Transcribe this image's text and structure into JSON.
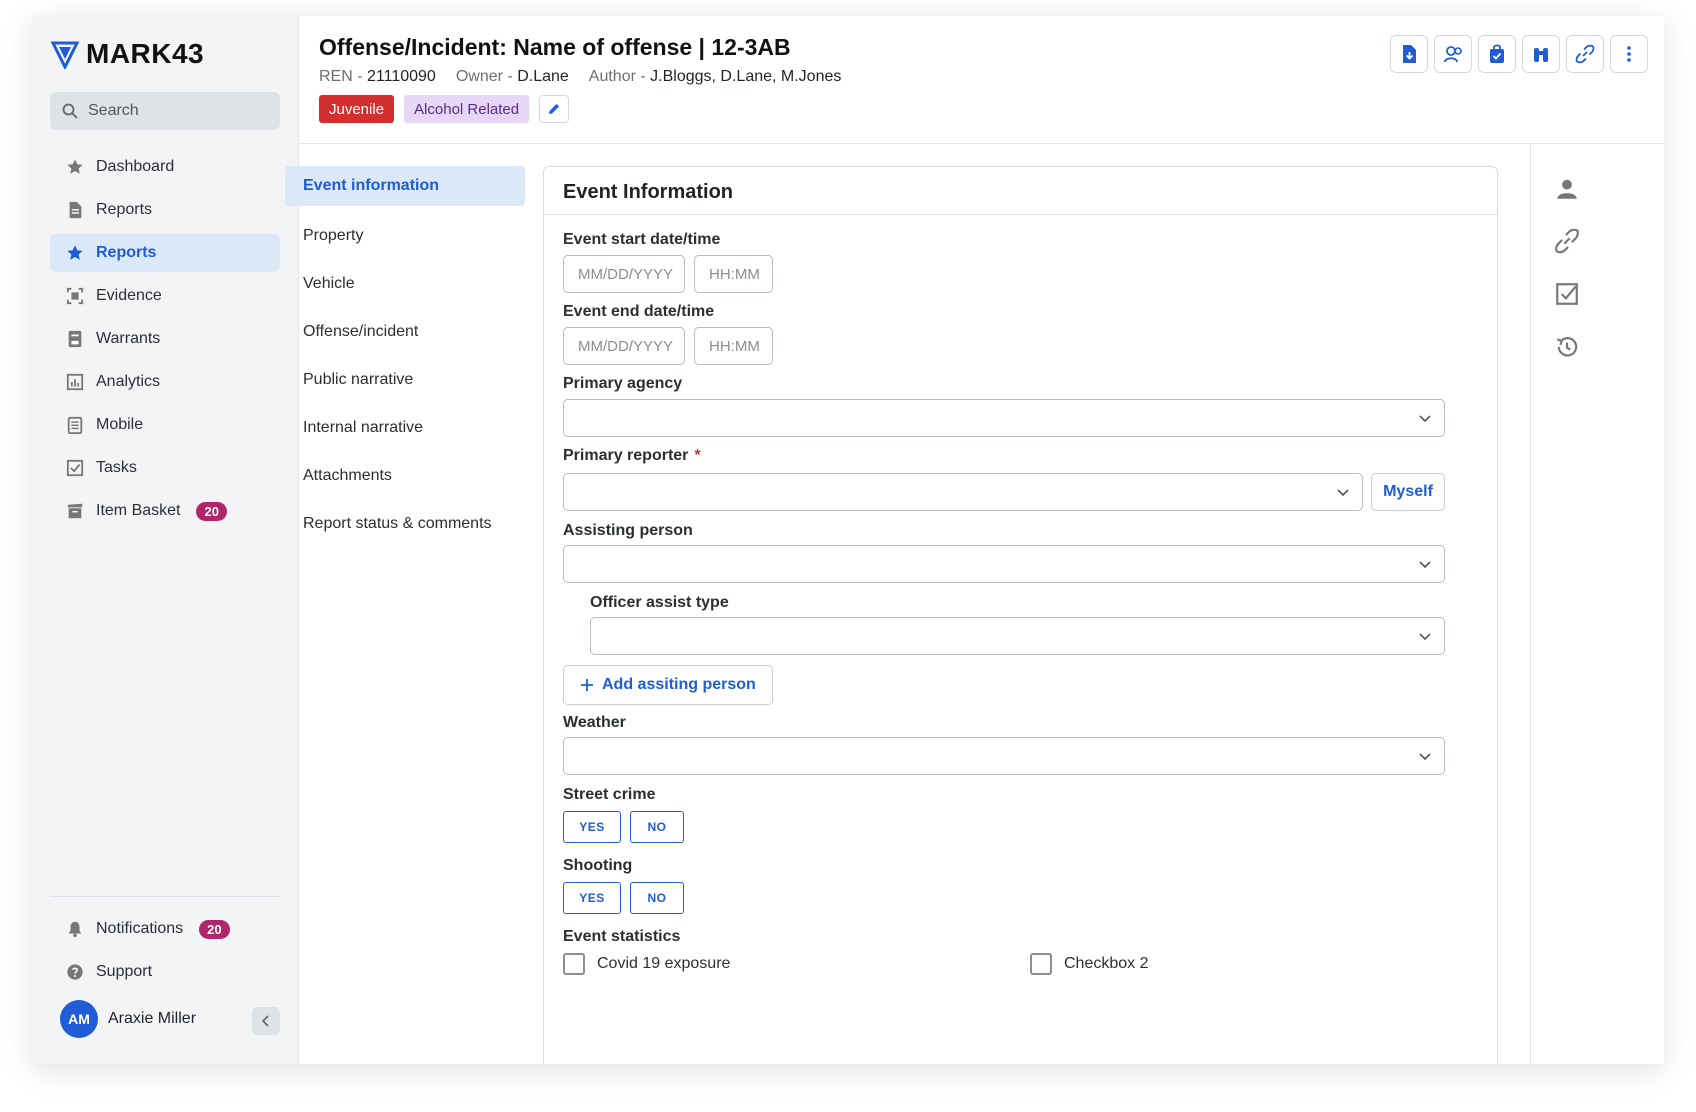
{
  "app": {
    "logo": "MARK43"
  },
  "sidebar": {
    "search_placeholder": "Search",
    "items": [
      {
        "label": "Dashboard",
        "icon": "star-icon",
        "active": false
      },
      {
        "label": "Reports",
        "icon": "document-icon",
        "active": false
      },
      {
        "label": "Reports",
        "icon": "star-icon",
        "active": true
      },
      {
        "label": "Evidence",
        "icon": "evidence-icon",
        "active": false
      },
      {
        "label": "Warrants",
        "icon": "warrant-icon",
        "active": false
      },
      {
        "label": "Analytics",
        "icon": "analytics-icon",
        "active": false
      },
      {
        "label": "Mobile",
        "icon": "mobile-icon",
        "active": false
      },
      {
        "label": "Tasks",
        "icon": "tasks-icon",
        "active": false
      },
      {
        "label": "Item Basket",
        "icon": "basket-icon",
        "active": false,
        "badge": "20"
      }
    ],
    "bottom": {
      "notifications": {
        "label": "Notifications",
        "badge": "20"
      },
      "support": {
        "label": "Support"
      }
    },
    "user": {
      "initials": "AM",
      "name": "Araxie Miller"
    }
  },
  "header": {
    "title": "Offense/Incident: Name of offense | 12-3AB",
    "ren_label": "REN -",
    "ren_value": "21110090",
    "owner_label": "Owner -",
    "owner_value": "D.Lane",
    "author_label": "Author -",
    "author_value": "J.Bloggs, D.Lane, M.Jones",
    "tags": [
      "Juvenile",
      "Alcohol Related"
    ]
  },
  "section_nav": [
    "Event information",
    "Property",
    "Vehicle",
    "Offense/incident",
    "Public narrative",
    "Internal narrative",
    "Attachments",
    "Report status & comments"
  ],
  "form": {
    "heading": "Event Information",
    "start_label": "Event start date/time",
    "end_label": "Event end date/time",
    "date_placeholder": "MM/DD/YYYY",
    "time_placeholder": "HH:MM",
    "agency_label": "Primary agency",
    "reporter_label": "Primary reporter",
    "reporter_required": "*",
    "myself_label": "Myself",
    "assisting_label": "Assisting person",
    "assist_type_label": "Officer assist type",
    "add_assisting_label": "Add assiting person",
    "weather_label": "Weather",
    "street_crime_label": "Street crime",
    "shooting_label": "Shooting",
    "yes_label": "YES",
    "no_label": "NO",
    "statistics_label": "Event statistics",
    "checkboxes": [
      "Covid 19 exposure",
      "Checkbox 2"
    ]
  },
  "colors": {
    "accent": "#1e5dd6",
    "active_bg": "#dbe8f8",
    "badge": "#b0266a",
    "tag_red": "#d32f2f",
    "tag_purple": "#e8d6f7"
  }
}
